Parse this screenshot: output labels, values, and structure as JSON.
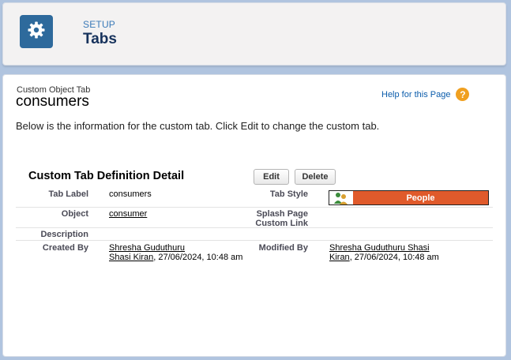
{
  "header": {
    "section": "SETUP",
    "title": "Tabs",
    "icon": "gear-icon"
  },
  "main": {
    "type_label": "Custom Object Tab",
    "record_name": "consumers",
    "help_link": "Help for this Page",
    "help_icon": "?",
    "intro": "Below is the information for the custom tab. Click Edit to change the custom tab.",
    "section_title": "Custom Tab Definition Detail",
    "buttons": {
      "edit": "Edit",
      "delete": "Delete"
    },
    "fields": {
      "tab_label": {
        "label": "Tab Label",
        "value": "consumers"
      },
      "tab_style": {
        "label": "Tab Style",
        "value": "People",
        "color": "#e05a2b",
        "icon": "people-icon"
      },
      "object": {
        "label": "Object",
        "value": "consumer"
      },
      "splash_page": {
        "label_line1": "Splash Page",
        "label_line2": "Custom Link",
        "value": ""
      },
      "description": {
        "label": "Description",
        "value": ""
      },
      "created_by": {
        "label": "Created By",
        "name_line1": "Shresha Guduthuru",
        "name_line2": "Shasi Kiran",
        "date": ", 27/06/2024, 10:48 am"
      },
      "modified_by": {
        "label": "Modified By",
        "name_line1": "Shresha Guduthuru Shasi",
        "name_line2": "Kiran",
        "date": ", 27/06/2024, 10:48 am"
      }
    }
  }
}
